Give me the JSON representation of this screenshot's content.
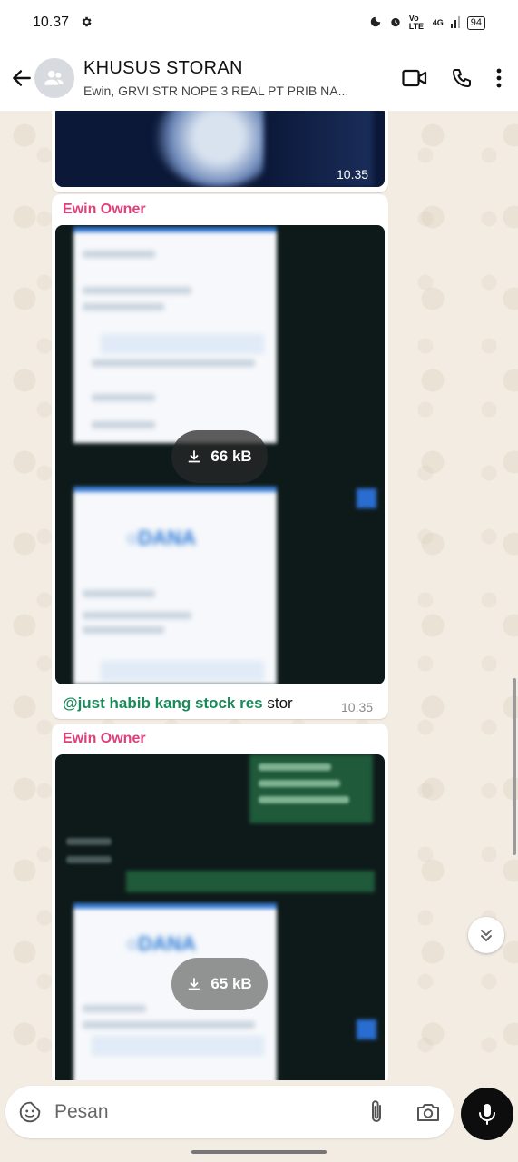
{
  "status_bar": {
    "time": "10.37",
    "network": "Vo LTE",
    "signal": "4G",
    "battery": "94"
  },
  "header": {
    "title": "KHUSUS STORAN",
    "subtitle": "Ewin, GRVI STR NOPE 3 REAL PT PRIB NA..."
  },
  "messages": [
    {
      "type": "image",
      "time": "10.35"
    },
    {
      "type": "image",
      "sender": "Ewin Owner",
      "download_size": "66 kB",
      "mention": "@just habib kang stock res",
      "caption": " stor",
      "time": "10.35"
    },
    {
      "type": "image",
      "sender": "Ewin Owner",
      "download_size": "65 kB"
    }
  ],
  "input": {
    "placeholder": "Pesan"
  },
  "colors": {
    "sender_name": "#e0407a",
    "mention": "#1b8a5a",
    "chat_background": "#f2ece3"
  }
}
